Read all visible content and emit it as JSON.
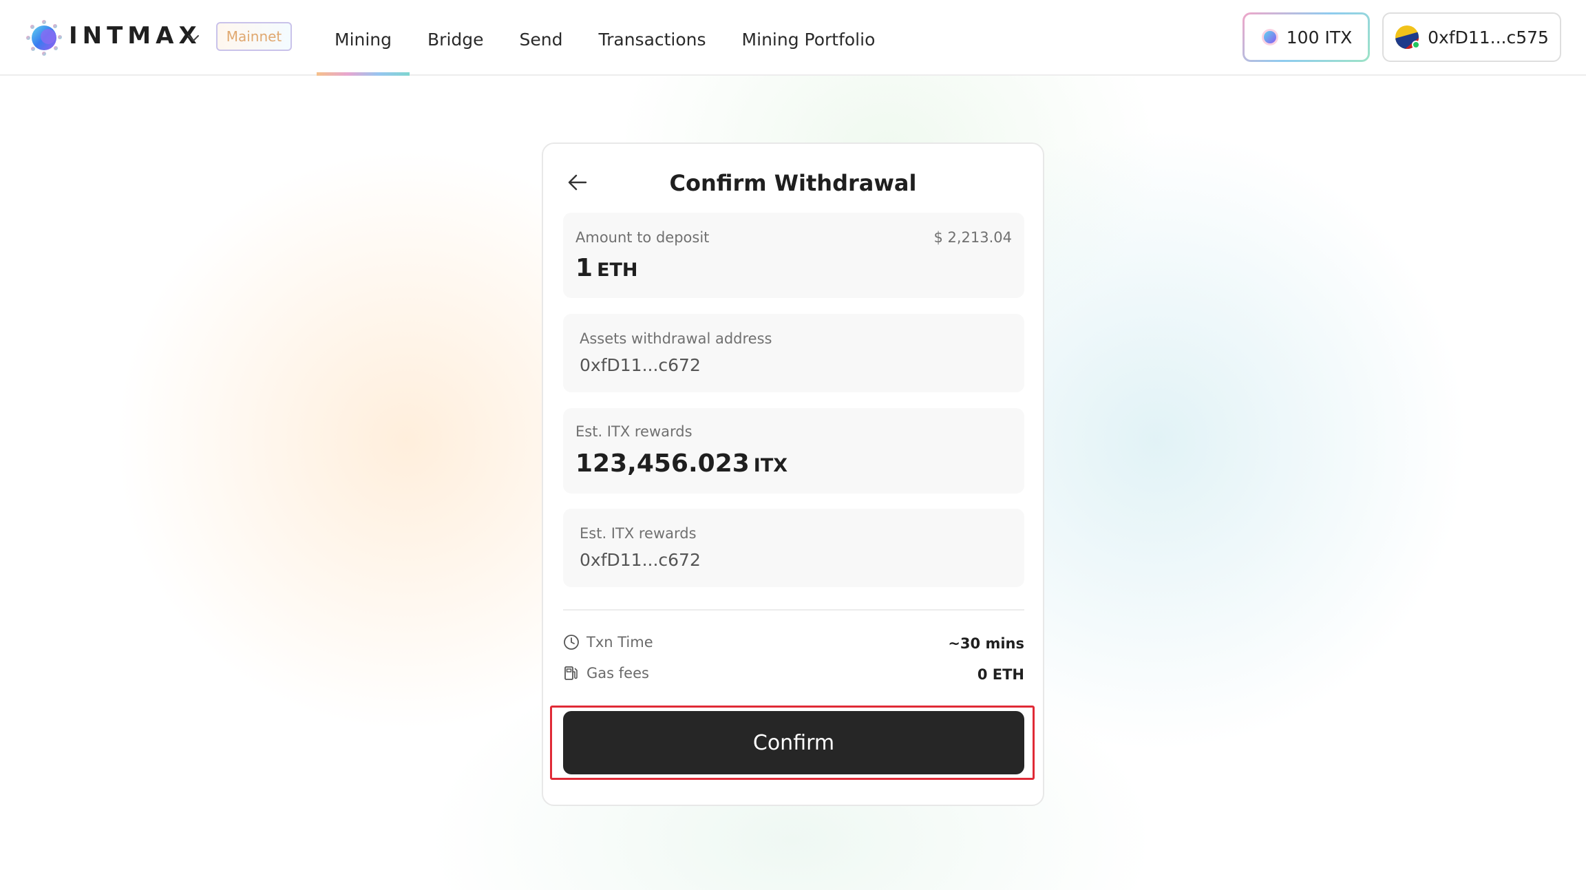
{
  "header": {
    "brand": "INTMAX",
    "network_badge": "Mainnet",
    "nav": [
      {
        "label": "Mining",
        "active": true
      },
      {
        "label": "Bridge",
        "active": false
      },
      {
        "label": "Send",
        "active": false
      },
      {
        "label": "Transactions",
        "active": false
      },
      {
        "label": "Mining Portfolio",
        "active": false
      }
    ],
    "itx_balance": "100 ITX",
    "wallet_address": "0xfD11...c575",
    "icons": {
      "logo": "intmax-logo-icon",
      "dropdown": "chevron-down-icon",
      "itx": "itx-token-icon",
      "wallet": "wallet-avatar-icon"
    }
  },
  "card": {
    "title": "Confirm Withdrawal",
    "back_icon": "arrow-left-icon",
    "amount": {
      "label": "Amount to deposit",
      "usd": "$ 2,213.04",
      "value": "1",
      "unit": "ETH"
    },
    "withdrawal_address": {
      "label": "Assets withdrawal address",
      "value": "0xfD11...c672"
    },
    "rewards": {
      "label": "Est. ITX rewards",
      "value": "123,456.023",
      "unit": "ITX"
    },
    "rewards_address": {
      "label": "Est. ITX rewards",
      "value": "0xfD11...c672"
    },
    "txn_time": {
      "label": "Txn Time",
      "value": "~30 mins",
      "icon": "clock-icon"
    },
    "gas_fees": {
      "label": "Gas fees",
      "value": "0 ETH",
      "icon": "gas-pump-icon"
    },
    "confirm_label": "Confirm"
  },
  "colors": {
    "confirm_bg": "#262626",
    "highlight": "#e02a36",
    "active_tab_gradient": [
      "#f5c08a",
      "#e7a6d0",
      "#97c5f0",
      "#7fd6d0"
    ]
  }
}
